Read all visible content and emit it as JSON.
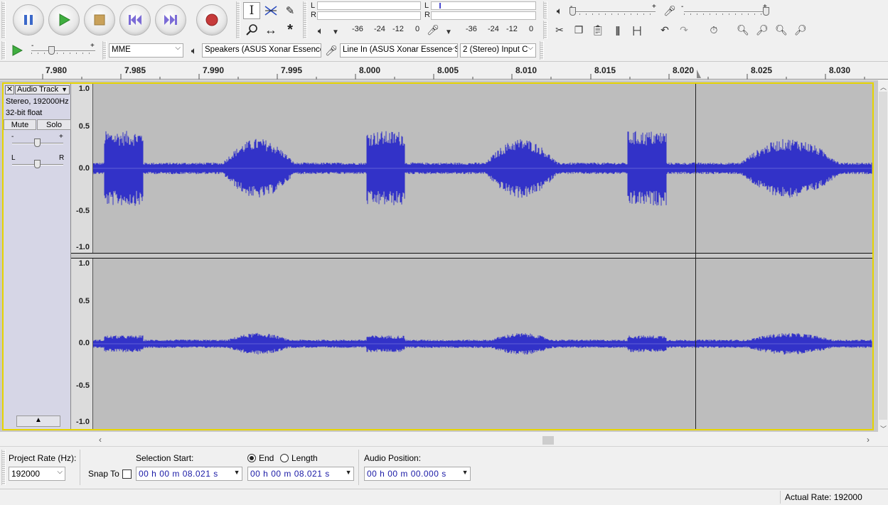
{
  "transport": {
    "pause_icon": "pause-icon",
    "play_icon": "play-icon",
    "stop_icon": "stop-icon",
    "skip_start_icon": "skip-to-start-icon",
    "skip_end_icon": "skip-to-end-icon",
    "record_icon": "record-icon"
  },
  "meters": {
    "play_left": "L",
    "play_right": "R",
    "rec_left": "L",
    "rec_right": "R",
    "scale": [
      "-36",
      "-24",
      "-12",
      "0"
    ]
  },
  "mixer": {
    "minus": "-",
    "plus": "+"
  },
  "device": {
    "host": "MME",
    "playback": "Speakers (ASUS Xonar Essence",
    "recording": "Line In (ASUS Xonar Essence S",
    "channels": "2 (Stereo) Input C"
  },
  "ruler": {
    "labels": [
      "7.980",
      "7.985",
      "7.990",
      "7.995",
      "8.000",
      "8.005",
      "8.010",
      "8.015",
      "8.020",
      "8.025",
      "8.030"
    ]
  },
  "track": {
    "name": "Audio Track",
    "info_format": "Stereo, 192000Hz",
    "info_bits": "32-bit float",
    "mute": "Mute",
    "solo": "Solo",
    "gain_minus": "-",
    "gain_plus": "+",
    "pan_left": "L",
    "pan_right": "R",
    "amplitude_labels": [
      "1.0",
      "0.5",
      "0.0",
      "-0.5",
      "-1.0"
    ],
    "waveform_color": "#3232c8",
    "frame_color": "#e6d400"
  },
  "selection": {
    "project_rate_label": "Project Rate (Hz):",
    "project_rate_value": "192000",
    "snap_to_label": "Snap To",
    "selection_start_label": "Selection Start:",
    "end_label": "End",
    "length_label": "Length",
    "audio_position_label": "Audio Position:",
    "start_value": "00 h 00 m 08.021 s",
    "end_value": "00 h 00 m 08.021 s",
    "position_value": "00 h 00 m 00.000 s"
  },
  "status": {
    "actual_rate": "Actual Rate: 192000"
  }
}
